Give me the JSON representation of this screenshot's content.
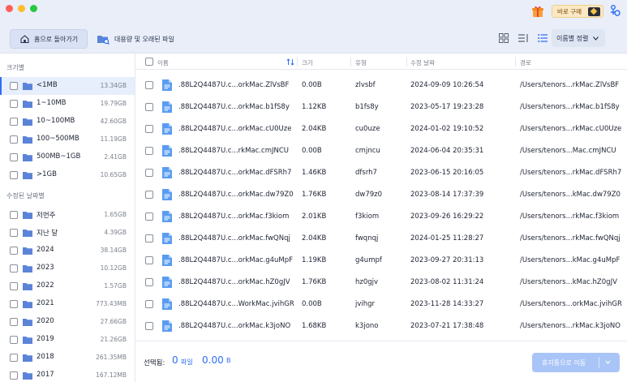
{
  "colors": {
    "accent": "#2e6df6",
    "folder": "#5b84d8",
    "file": "#5a9cf2"
  },
  "header": {
    "home_label": "홈으로 돌아가기",
    "large_files_label": "대용량 및 오래된 파일",
    "buy_label": "바로 구매",
    "sort_label": "이름별 정렬"
  },
  "sidebar": {
    "size_title": "크기별",
    "size_items": [
      {
        "label": "<1MB",
        "size": "13.34GB"
      },
      {
        "label": "1~10MB",
        "size": "19.79GB"
      },
      {
        "label": "10~100MB",
        "size": "42.60GB"
      },
      {
        "label": "100~500MB",
        "size": "11.19GB"
      },
      {
        "label": "500MB~1GB",
        "size": "2.41GB"
      },
      {
        "label": ">1GB",
        "size": "10.65GB"
      }
    ],
    "date_title": "수정된 날짜별",
    "date_items": [
      {
        "label": "저번주",
        "size": "1.65GB"
      },
      {
        "label": "지난 달",
        "size": "4.39GB"
      },
      {
        "label": "2024",
        "size": "38.14GB"
      },
      {
        "label": "2023",
        "size": "10.12GB"
      },
      {
        "label": "2022",
        "size": "1.57GB"
      },
      {
        "label": "2021",
        "size": "773.43MB"
      },
      {
        "label": "2020",
        "size": "27.66GB"
      },
      {
        "label": "2019",
        "size": "21.26GB"
      },
      {
        "label": "2018",
        "size": "261.35MB"
      },
      {
        "label": "2017",
        "size": "167.12MB"
      }
    ]
  },
  "table": {
    "columns": {
      "name": "이름",
      "size": "크기",
      "type": "유형",
      "date": "수정 날짜",
      "path": "경로"
    },
    "rows": [
      {
        "name": ".88L2Q4487U.c...orkMac.ZlVsBF",
        "size": "0.00B",
        "type": "zlvsbf",
        "date": "2024-09-09 10:26:54",
        "path": "/Users/tenors...rkMac.ZlVsBF"
      },
      {
        "name": ".88L2Q4487U.c...orkMac.b1fS8y",
        "size": "1.12KB",
        "type": "b1fs8y",
        "date": "2023-05-17 19:23:28",
        "path": "/Users/tenors...rkMac.b1fS8y"
      },
      {
        "name": ".88L2Q4487U.c...orkMac.cU0Uze",
        "size": "2.04KB",
        "type": "cu0uze",
        "date": "2024-01-02 19:10:52",
        "path": "/Users/tenors...rkMac.cU0Uze"
      },
      {
        "name": ".88L2Q4487U.c...rkMac.cmJNCU",
        "size": "0.00B",
        "type": "cmjncu",
        "date": "2024-06-04 20:35:31",
        "path": "/Users/tenors...Mac.cmJNCU"
      },
      {
        "name": ".88L2Q4487U.c...orkMac.dFSRh7",
        "size": "1.46KB",
        "type": "dfsrh7",
        "date": "2023-06-15 20:16:05",
        "path": "/Users/tenors...rkMac.dFSRh7"
      },
      {
        "name": ".88L2Q4487U.c...orkMac.dw79Z0",
        "size": "1.76KB",
        "type": "dw79z0",
        "date": "2023-08-14 17:37:39",
        "path": "/Users/tenors...kMac.dw79Z0"
      },
      {
        "name": ".88L2Q4487U.c...orkMac.f3kiom",
        "size": "2.01KB",
        "type": "f3kiom",
        "date": "2023-09-26 16:29:22",
        "path": "/Users/tenors...rkMac.f3kiom"
      },
      {
        "name": ".88L2Q4487U.c...orkMac.fwQNqj",
        "size": "2.04KB",
        "type": "fwqnqj",
        "date": "2024-01-25 11:28:27",
        "path": "/Users/tenors...rkMac.fwQNqj"
      },
      {
        "name": ".88L2Q4487U.c...orkMac.g4uMpF",
        "size": "1.19KB",
        "type": "g4umpf",
        "date": "2023-09-27 20:31:13",
        "path": "/Users/tenors...kMac.g4uMpF"
      },
      {
        "name": ".88L2Q4487U.c...orkMac.hZ0gJV",
        "size": "1.76KB",
        "type": "hz0gjv",
        "date": "2023-08-02 11:31:24",
        "path": "/Users/tenors...kMac.hZ0gJV"
      },
      {
        "name": ".88L2Q4487U.c...WorkMac.jvihGR",
        "size": "0.00B",
        "type": "jvihgr",
        "date": "2023-11-28 14:33:27",
        "path": "/Users/tenors...orkMac.jvihGR"
      },
      {
        "name": ".88L2Q4487U.c...orkMac.k3joNO",
        "size": "1.68KB",
        "type": "k3jono",
        "date": "2023-07-21 17:38:48",
        "path": "/Users/tenors...rkMac.k3joNO"
      }
    ]
  },
  "footer": {
    "selected_label": "선택됨:",
    "count": "0",
    "count_unit": "파일",
    "size": "0.00",
    "size_unit": "B",
    "trash_label": "휴지통으로 이동"
  }
}
